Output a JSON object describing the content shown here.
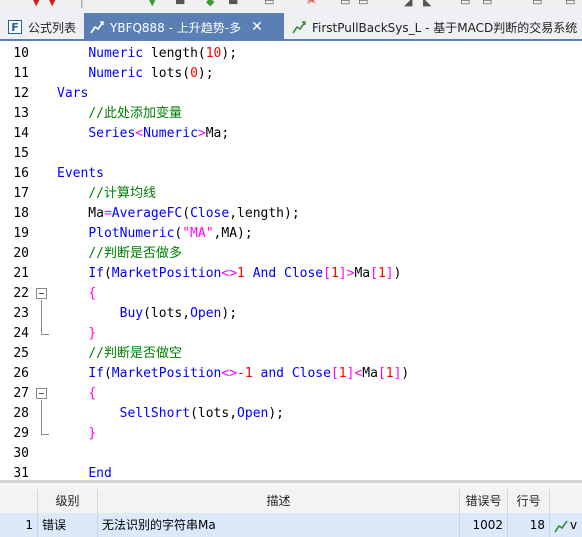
{
  "tabs": [
    {
      "label": "公式列表",
      "icon": "formula-list-icon",
      "active": false
    },
    {
      "label": "YBFQ888 - 上升趋势-多",
      "icon": "strategy-icon",
      "active": true
    },
    {
      "label": "FirstPullBackSys_L - 基于MACD判断的交易系统",
      "icon": "strategy-icon",
      "active": false
    }
  ],
  "code_lines": [
    {
      "n": "10",
      "tokens": [
        [
          "t",
          "    "
        ],
        [
          "k",
          "Numeric"
        ],
        [
          "t",
          " length("
        ],
        [
          "n",
          "10"
        ],
        [
          "t",
          ");"
        ]
      ]
    },
    {
      "n": "11",
      "tokens": [
        [
          "t",
          "    "
        ],
        [
          "k",
          "Numeric"
        ],
        [
          "t",
          " lots("
        ],
        [
          "n",
          "0"
        ],
        [
          "t",
          ");"
        ]
      ]
    },
    {
      "n": "12",
      "tokens": [
        [
          "k",
          "Vars"
        ]
      ]
    },
    {
      "n": "13",
      "tokens": [
        [
          "t",
          "    "
        ],
        [
          "c",
          "//此处添加变量"
        ]
      ]
    },
    {
      "n": "14",
      "tokens": [
        [
          "t",
          "    "
        ],
        [
          "k",
          "Series"
        ],
        [
          "o",
          "<"
        ],
        [
          "k",
          "Numeric"
        ],
        [
          "o",
          ">"
        ],
        [
          "t",
          "Ma;"
        ]
      ]
    },
    {
      "n": "15",
      "tokens": []
    },
    {
      "n": "16",
      "tokens": [
        [
          "k",
          "Events"
        ]
      ]
    },
    {
      "n": "17",
      "tokens": [
        [
          "t",
          "    "
        ],
        [
          "c",
          "//计算均线"
        ]
      ]
    },
    {
      "n": "18",
      "tokens": [
        [
          "t",
          "    Ma"
        ],
        [
          "o",
          "="
        ],
        [
          "k",
          "AverageFC"
        ],
        [
          "t",
          "("
        ],
        [
          "k",
          "Close"
        ],
        [
          "t",
          ",length);"
        ]
      ]
    },
    {
      "n": "19",
      "tokens": [
        [
          "t",
          "    "
        ],
        [
          "k",
          "PlotNumeric"
        ],
        [
          "t",
          "("
        ],
        [
          "s",
          "\"MA\""
        ],
        [
          "t",
          ",MA);"
        ]
      ]
    },
    {
      "n": "20",
      "tokens": [
        [
          "t",
          "    "
        ],
        [
          "c",
          "//判断是否做多"
        ]
      ]
    },
    {
      "n": "21",
      "tokens": [
        [
          "t",
          "    "
        ],
        [
          "k",
          "If"
        ],
        [
          "t",
          "("
        ],
        [
          "k",
          "MarketPosition"
        ],
        [
          "o",
          "<>"
        ],
        [
          "n",
          "1"
        ],
        [
          "t",
          " "
        ],
        [
          "k",
          "And"
        ],
        [
          "t",
          " "
        ],
        [
          "k",
          "Close"
        ],
        [
          "o",
          "["
        ],
        [
          "n",
          "1"
        ],
        [
          "o",
          "]"
        ],
        [
          "o",
          ">"
        ],
        [
          "t",
          "Ma"
        ],
        [
          "o",
          "["
        ],
        [
          "n",
          "1"
        ],
        [
          "o",
          "]"
        ],
        [
          "t",
          ")"
        ]
      ]
    },
    {
      "n": "22",
      "tokens": [
        [
          "t",
          "    "
        ],
        [
          "o",
          "{"
        ]
      ]
    },
    {
      "n": "23",
      "tokens": [
        [
          "t",
          "        "
        ],
        [
          "k",
          "Buy"
        ],
        [
          "t",
          "(lots,"
        ],
        [
          "k",
          "Open"
        ],
        [
          "t",
          ");"
        ]
      ]
    },
    {
      "n": "24",
      "tokens": [
        [
          "t",
          "    "
        ],
        [
          "o",
          "}"
        ]
      ]
    },
    {
      "n": "25",
      "tokens": [
        [
          "t",
          "    "
        ],
        [
          "c",
          "//判断是否做空"
        ]
      ]
    },
    {
      "n": "26",
      "tokens": [
        [
          "t",
          "    "
        ],
        [
          "k",
          "If"
        ],
        [
          "t",
          "("
        ],
        [
          "k",
          "MarketPosition"
        ],
        [
          "o",
          "<>"
        ],
        [
          "n",
          "-1"
        ],
        [
          "t",
          " "
        ],
        [
          "k",
          "and"
        ],
        [
          "t",
          " "
        ],
        [
          "k",
          "Close"
        ],
        [
          "o",
          "["
        ],
        [
          "n",
          "1"
        ],
        [
          "o",
          "]"
        ],
        [
          "o",
          "<"
        ],
        [
          "t",
          "Ma"
        ],
        [
          "o",
          "["
        ],
        [
          "n",
          "1"
        ],
        [
          "o",
          "]"
        ],
        [
          "t",
          ")"
        ]
      ]
    },
    {
      "n": "27",
      "tokens": [
        [
          "t",
          "    "
        ],
        [
          "o",
          "{"
        ]
      ]
    },
    {
      "n": "28",
      "tokens": [
        [
          "t",
          "        "
        ],
        [
          "k",
          "SellShort"
        ],
        [
          "t",
          "(lots,"
        ],
        [
          "k",
          "Open"
        ],
        [
          "t",
          ");"
        ]
      ]
    },
    {
      "n": "29",
      "tokens": [
        [
          "t",
          "    "
        ],
        [
          "o",
          "}"
        ]
      ]
    },
    {
      "n": "30",
      "tokens": []
    },
    {
      "n": "31",
      "tokens": [
        [
          "t",
          "    "
        ],
        [
          "k",
          "End"
        ]
      ]
    }
  ],
  "error_panel": {
    "headers": [
      "级别",
      "描述",
      "错误号",
      "行号"
    ],
    "rows": [
      {
        "index": "1",
        "level": "错误",
        "description": "无法识别的字符串Ma",
        "code": "1002",
        "line": "18",
        "extra": "v"
      }
    ]
  },
  "colors": {
    "keyword": "#0000ff",
    "operator": "#ff00ff",
    "number": "#ff0000",
    "comment": "#008000",
    "tab_active": "#5a7fb5",
    "row_selected": "#dbe9f9"
  }
}
